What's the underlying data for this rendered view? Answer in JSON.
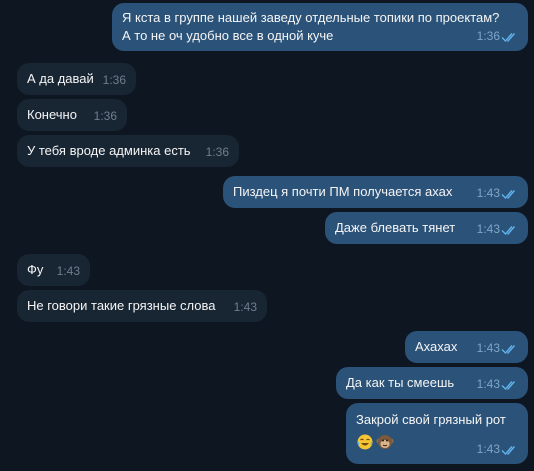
{
  "messages": [
    {
      "side": "out",
      "lines": [
        "Я кста в группе нашей заведу отдельные топики по проектам?",
        "А то не оч удобно все в одной куче"
      ],
      "time": "1:36",
      "read": true
    },
    {
      "side": "in",
      "text": "А да давай",
      "time": "1:36"
    },
    {
      "side": "in",
      "text": "Конечно",
      "time": "1:36"
    },
    {
      "side": "in",
      "text": "У тебя вроде админка есть",
      "time": "1:36"
    },
    {
      "side": "out",
      "text": "Пиздец я почти ПМ получается ахах",
      "time": "1:43",
      "read": true
    },
    {
      "side": "out",
      "text": "Даже блевать тянет",
      "time": "1:43",
      "read": true
    },
    {
      "side": "in",
      "text": "Фу",
      "time": "1:43"
    },
    {
      "side": "in",
      "text": "Не говори такие грязные слова",
      "time": "1:43"
    },
    {
      "side": "out",
      "text": "Ахахах",
      "time": "1:43",
      "read": true
    },
    {
      "side": "out",
      "text": "Да как ты смеешь",
      "time": "1:43",
      "read": true
    },
    {
      "side": "out",
      "text": "Закрой свой грязный рот",
      "emojis": [
        "face-with-tears-of-joy-emoji",
        "monkey-emoji"
      ],
      "time": "1:43",
      "read": true
    }
  ],
  "colors": {
    "background": "#0e1621",
    "incoming_bubble": "#182533",
    "outgoing_bubble": "#2b5278",
    "read_checks": "#5fb4ee"
  }
}
